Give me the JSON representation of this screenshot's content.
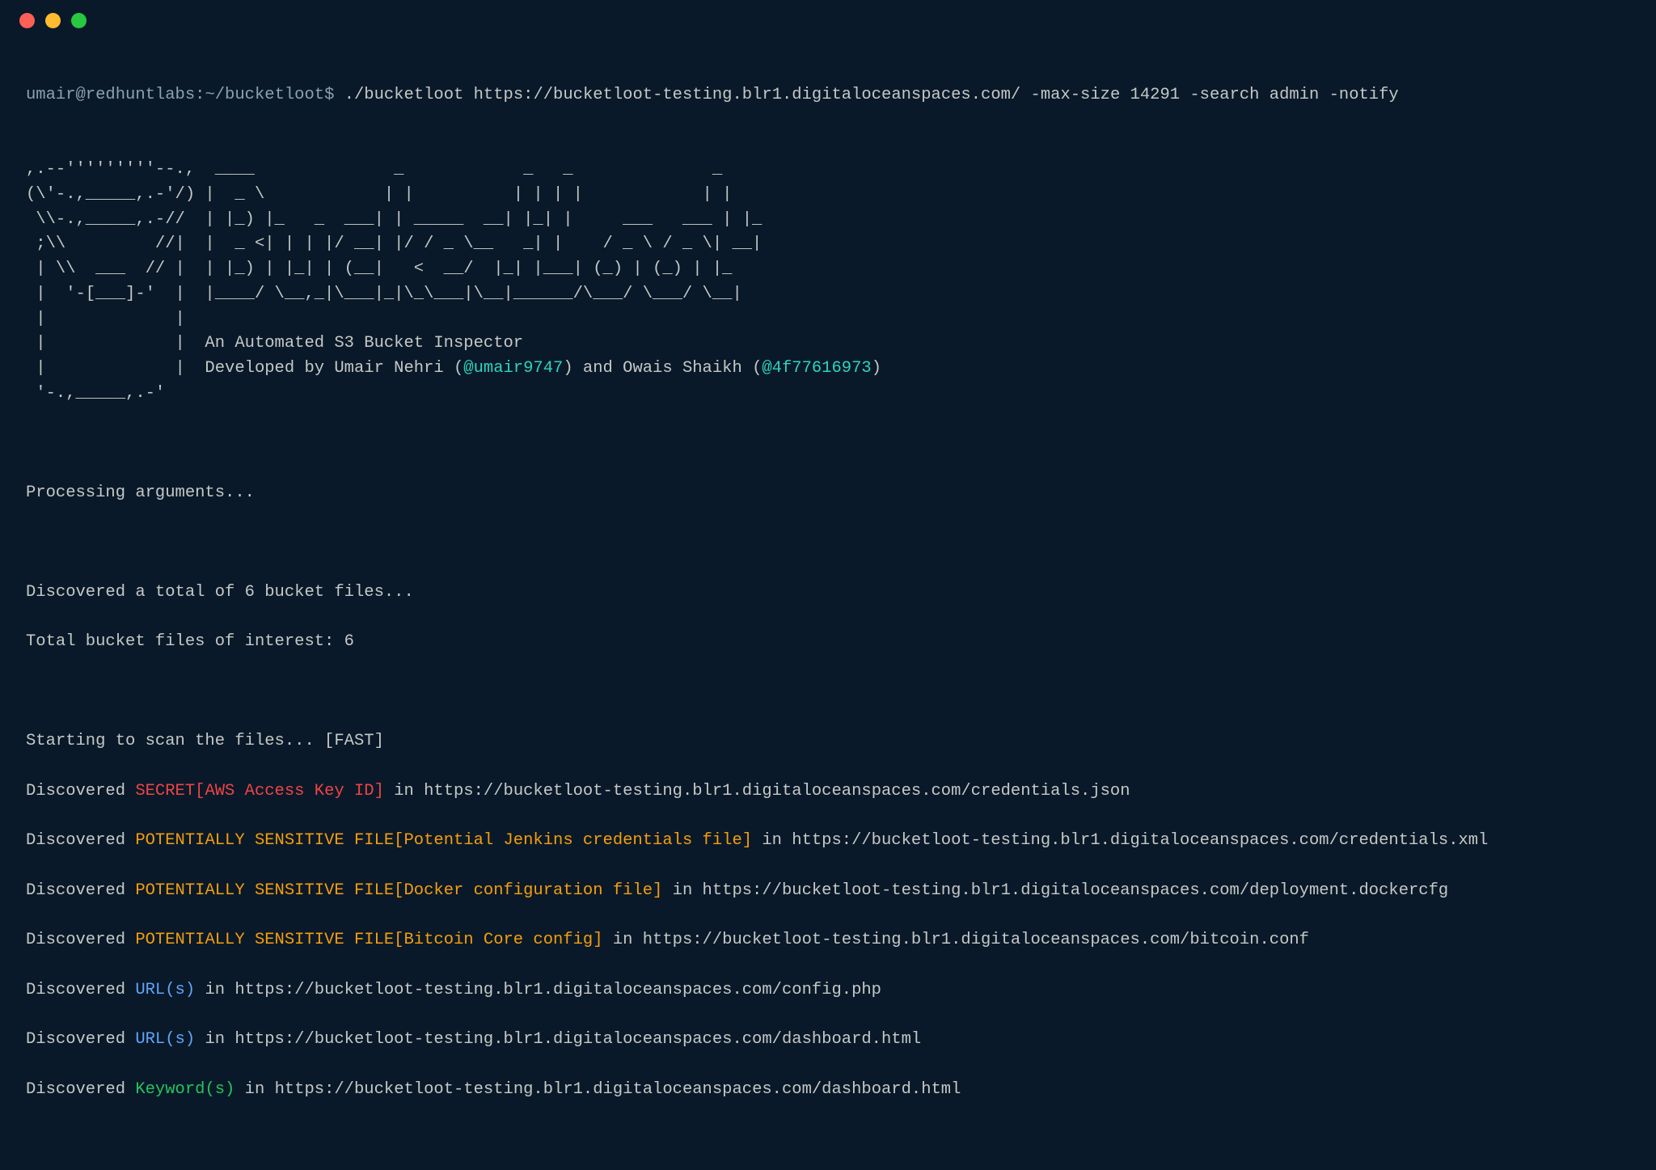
{
  "prompt": {
    "user_host": "umair@redhuntlabs",
    "cwd": "~/bucketloot",
    "symbol": "$",
    "command": "./bucketloot https://bucketloot-testing.blr1.digitaloceanspaces.com/ -max-size 14291 -search admin -notify"
  },
  "ascii": {
    "l1": ",.--'''''''''--.,  ____              _            _   _              _",
    "l2": "(\\'-.,_____,.-'/) |  _ \\            | |          | | | |            | |",
    "l3": " \\\\-.,_____,.-//  | |_) |_   _  ___| | _____  __| |_| |     ___   ___ | |_",
    "l4": " ;\\\\         //|  |  _ <| | | |/ __| |/ / _ \\__   _| |    / _ \\ / _ \\| __|",
    "l5": " | \\\\  ___  // |  | |_) | |_| | (__|   <  __/  |_| |___| (_) | (_) | |_",
    "l6": " |  '-[___]-'  |  |____/ \\__,_|\\___|_|\\_\\___|\\__|______/\\___/ \\___/ \\__|",
    "l7": " |             |",
    "l8": " |             |  An Automated S3 Bucket Inspector",
    "l9a": " |             |  Developed by Umair Nehri (",
    "l9b": "@umair9747",
    "l9c": ") and Owais Shaikh (",
    "l9d": "@4f77616973",
    "l9e": ")",
    "l10": " '-.,_____,.-'"
  },
  "status": {
    "processing": "Processing arguments...",
    "discovered_total": "Discovered a total of 6 bucket files...",
    "files_of_interest": "Total bucket files of interest: 6",
    "starting": "Starting to scan the files... [FAST]"
  },
  "findings": {
    "f1_pre": "Discovered ",
    "f1_tag": "SECRET[AWS Access Key ID]",
    "f1_post": " in https://bucketloot-testing.blr1.digitaloceanspaces.com/credentials.json",
    "f2_pre": "Discovered ",
    "f2_tag": "POTENTIALLY SENSITIVE FILE[Potential Jenkins credentials file]",
    "f2_post": " in https://bucketloot-testing.blr1.digitaloceanspaces.com/credentials.xml",
    "f3_pre": "Discovered ",
    "f3_tag": "POTENTIALLY SENSITIVE FILE[Docker configuration file]",
    "f3_post": " in https://bucketloot-testing.blr1.digitaloceanspaces.com/deployment.dockercfg",
    "f4_pre": "Discovered ",
    "f4_tag": "POTENTIALLY SENSITIVE FILE[Bitcoin Core config]",
    "f4_post": " in https://bucketloot-testing.blr1.digitaloceanspaces.com/bitcoin.conf",
    "f5_pre": "Discovered ",
    "f5_tag": "URL(s)",
    "f5_post": " in https://bucketloot-testing.blr1.digitaloceanspaces.com/config.php",
    "f6_pre": "Discovered ",
    "f6_tag": "URL(s)",
    "f6_post": " in https://bucketloot-testing.blr1.digitaloceanspaces.com/dashboard.html",
    "f7_pre": "Discovered ",
    "f7_tag": "Keyword(s)",
    "f7_post": " in https://bucketloot-testing.blr1.digitaloceanspaces.com/dashboard.html"
  },
  "colors": {
    "bg": "#0a1929",
    "fg": "#c5c8c6",
    "cyan": "#2dd4bf",
    "red": "#ef4444",
    "orange": "#f59e0b",
    "blue": "#60a5fa",
    "green": "#22c55e"
  }
}
